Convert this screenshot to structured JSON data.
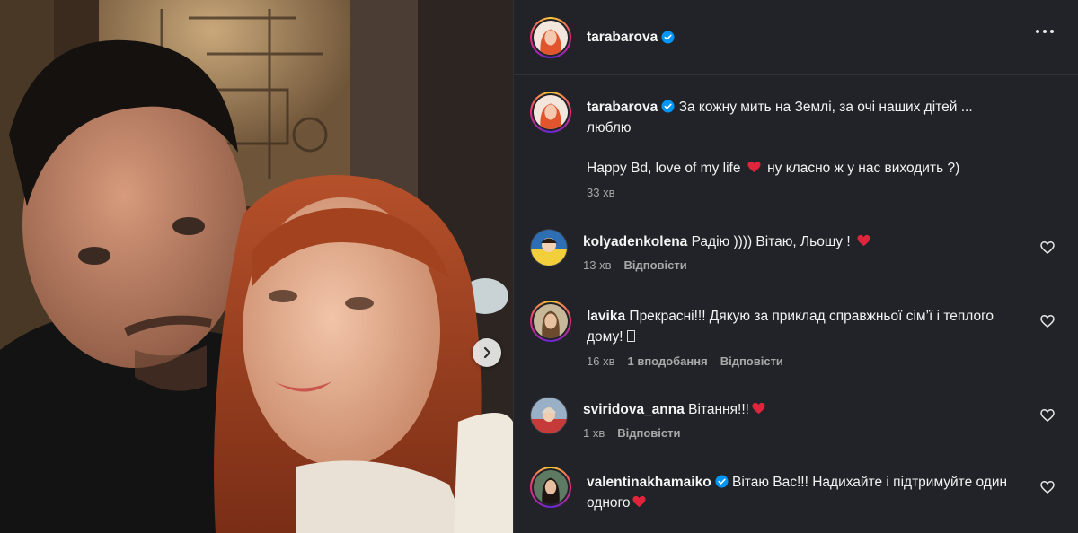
{
  "post": {
    "author": "tarabarova",
    "verified": true
  },
  "caption": {
    "username": "tarabarova",
    "text_line1": "За кожну мить на Землі, за очі наших дітей ... люблю",
    "text_line2_pre": "Happy Bd, love of my life",
    "text_line2_post": "ну класно ж у нас виходить ?)",
    "time": "33 хв"
  },
  "comments": [
    {
      "username": "kolyadenkolena",
      "text": "Радію )))) Вітаю, Льошу !",
      "has_heart_emoji": true,
      "time": "13 хв",
      "likes": "",
      "reply": "Відповісти"
    },
    {
      "username": "lavika",
      "text": "Прекрасні!!! Дякую за приклад справжньої сім’ї і теплого дому!",
      "has_box_glyph": true,
      "time": "16 хв",
      "likes": "1 вподобання",
      "reply": "Відповісти"
    },
    {
      "username": "sviridova_anna",
      "text": "Вітання!!!",
      "has_heart_emoji": true,
      "time": "1 хв",
      "likes": "",
      "reply": "Відповісти"
    },
    {
      "username": "valentinakhamaiko",
      "verified": true,
      "text": "Вітаю Вас!!! Надихайте і підтримуйте один одного",
      "has_heart_emoji": true,
      "time": "",
      "likes": "",
      "reply": ""
    }
  ],
  "colors": {
    "panel_bg": "#212328",
    "heart_emoji": "#e0243b",
    "verified_blue": "#0095f6",
    "meta_text": "#a8a8a8"
  },
  "icons": {
    "carousel_next": "chevron-right-icon",
    "more": "more-horizontal-icon",
    "like": "heart-outline-icon",
    "verified": "verified-badge-icon"
  }
}
